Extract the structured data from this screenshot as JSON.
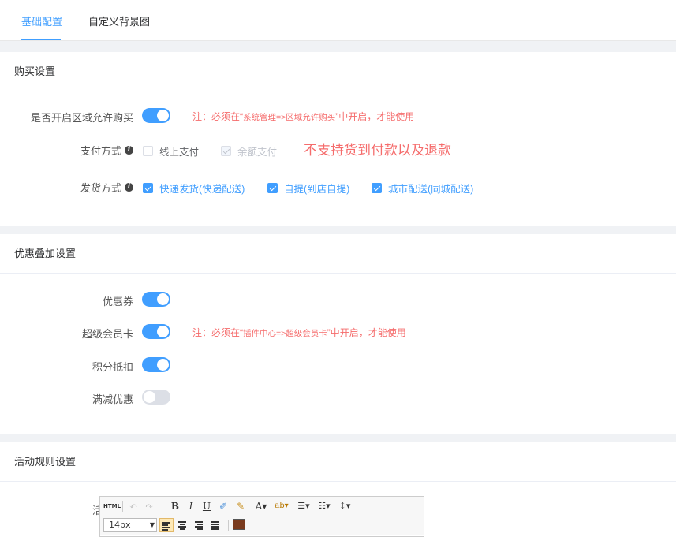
{
  "tabs": [
    {
      "label": "基础配置",
      "active": true
    },
    {
      "label": "自定义背景图",
      "active": false
    }
  ],
  "purchase": {
    "title": "购买设置",
    "region_label": "是否开启区域允许购买",
    "region_enabled": true,
    "region_note_prefix": "注：必须在“",
    "region_note_mid": "系统管理=>区域允许购买",
    "region_note_suffix": "”中开启，才能使用",
    "pay_label": "支付方式",
    "pay_options": [
      {
        "label": "线上支付",
        "checked": false,
        "disabled": false
      },
      {
        "label": "余额支付",
        "checked": true,
        "disabled": true
      }
    ],
    "pay_warning": "不支持货到付款以及退款",
    "ship_label": "发货方式",
    "ship_options": [
      {
        "label": "快递发货(快递配送)",
        "checked": true
      },
      {
        "label": "自提(到店自提)",
        "checked": true
      },
      {
        "label": "城市配送(同城配送)",
        "checked": true
      }
    ]
  },
  "discount": {
    "title": "优惠叠加设置",
    "coupon_label": "优惠券",
    "coupon_enabled": true,
    "vip_label": "超级会员卡",
    "vip_enabled": true,
    "vip_note_prefix": "注：必须在“",
    "vip_note_mid": "插件中心=>超级会员卡",
    "vip_note_suffix": "”中开启，才能使用",
    "points_label": "积分抵扣",
    "points_enabled": true,
    "fullcut_label": "满减优惠",
    "fullcut_enabled": false
  },
  "rules": {
    "title": "活动规则设置",
    "label": "活动规则",
    "font_size": "14px",
    "html_btn": "HTML"
  },
  "colors": {
    "accent": "#409eff",
    "warning": "#f56c6c"
  }
}
